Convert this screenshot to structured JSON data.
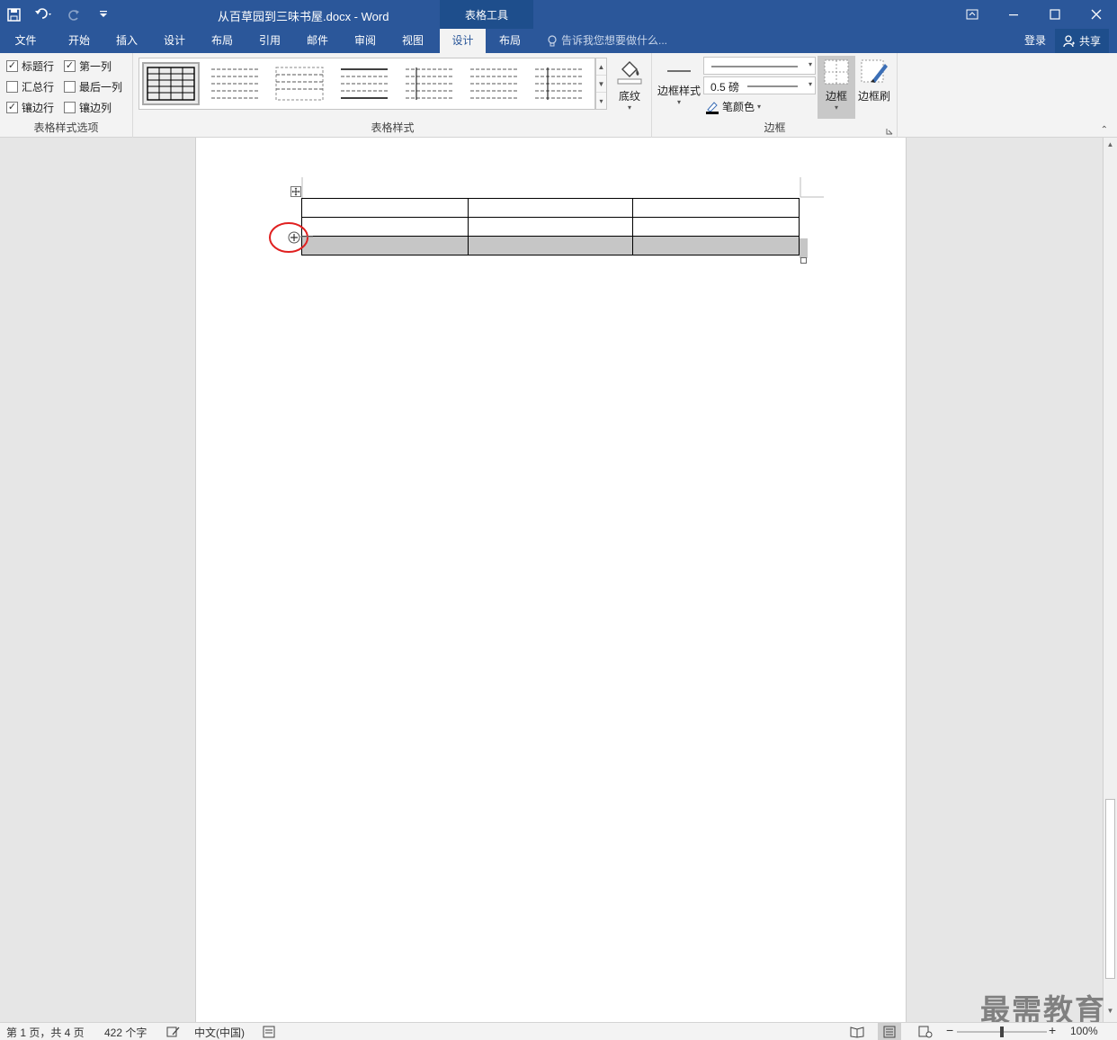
{
  "app": {
    "document_title": "从百草园到三味书屋.docx - Word",
    "context_tab_group": "表格工具"
  },
  "tabs": [
    "文件",
    "开始",
    "插入",
    "设计",
    "布局",
    "引用",
    "邮件",
    "审阅",
    "视图",
    "设计",
    "布局"
  ],
  "active_tab_index": 9,
  "tell_me": "告诉我您想要做什么...",
  "signin": "登录",
  "share": "共享",
  "ribbon": {
    "style_options": {
      "label": "表格样式选项",
      "items": [
        {
          "label": "标题行",
          "checked": true
        },
        {
          "label": "第一列",
          "checked": true
        },
        {
          "label": "汇总行",
          "checked": false
        },
        {
          "label": "最后一列",
          "checked": false
        },
        {
          "label": "镶边行",
          "checked": true
        },
        {
          "label": "镶边列",
          "checked": false
        }
      ]
    },
    "table_styles": {
      "label": "表格样式",
      "shading": "底纹"
    },
    "borders": {
      "label": "边框",
      "border_styles": "边框样式",
      "weight": "0.5 磅",
      "pen_color": "笔颜色",
      "borders_button": "边框",
      "border_painter": "边框刷"
    }
  },
  "status": {
    "page": "第 1 页，共 4 页",
    "words": "422 个字",
    "language": "中文(中国)",
    "zoom": "100%"
  },
  "watermark": "最需教育",
  "colors": {
    "word_blue": "#2b579a",
    "annotation_red": "#e02020"
  }
}
